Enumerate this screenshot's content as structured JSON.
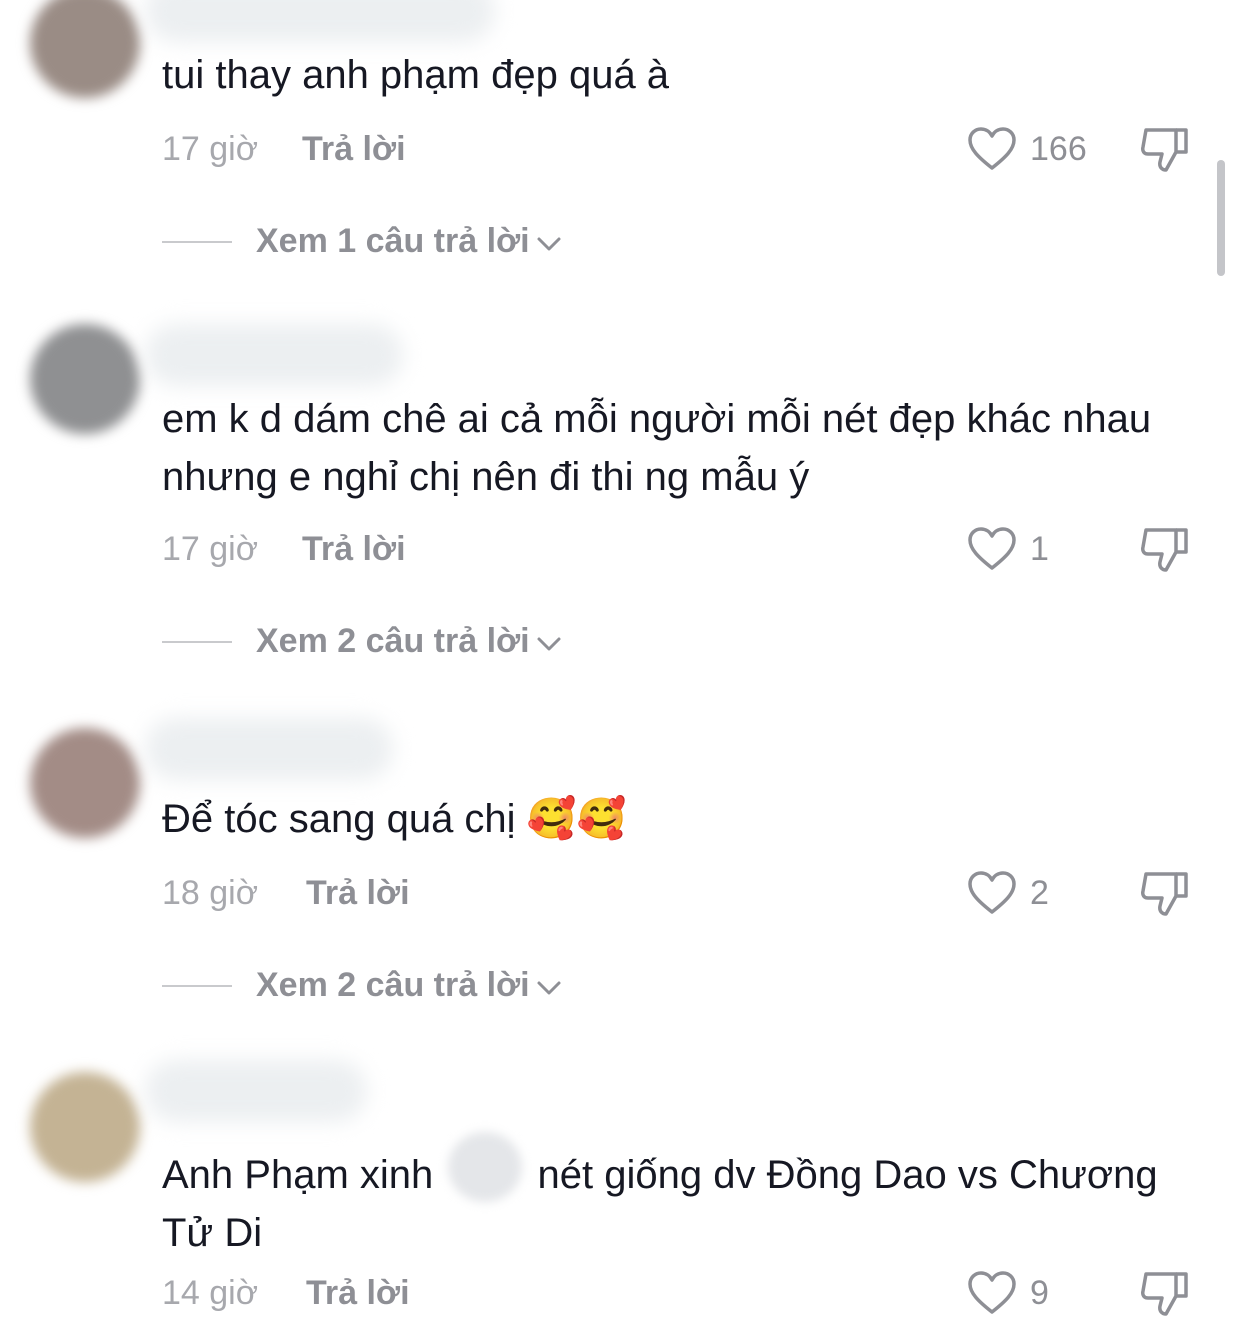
{
  "comments": [
    {
      "text": "tui thay anh phạm đẹp quá à",
      "time": "17 giờ",
      "reply_label": "Trả lời",
      "likes": "166",
      "view_replies": "Xem 1 câu trả lời",
      "avatar_color": "#9a8c85"
    },
    {
      "text": "em k d dám chê ai cả mỗi người mỗi nét đẹp khác nhau nhưng e nghỉ chị nên đi thi ng mẫu ý",
      "time": "17 giờ",
      "reply_label": "Trả lời",
      "likes": "1",
      "view_replies": "Xem 2 câu trả lời",
      "avatar_color": "#8f9092"
    },
    {
      "text": "Để tóc sang quá chị",
      "emoji": "🥰🥰",
      "time": "18 giờ",
      "reply_label": "Trả lời",
      "likes": "2",
      "view_replies": "Xem 2 câu trả lời",
      "avatar_color": "#a38c86"
    },
    {
      "text_before": "Anh Phạm xinh",
      "text_after": "nét giống dv Đồng Dao vs Chương Tử Di",
      "time": "14 giờ",
      "reply_label": "Trả lời",
      "likes": "9",
      "avatar_color": "#c4b394"
    }
  ],
  "icons": {
    "like": "heart-outline-icon",
    "dislike": "thumbs-down-icon",
    "expand": "chevron-down-icon"
  }
}
